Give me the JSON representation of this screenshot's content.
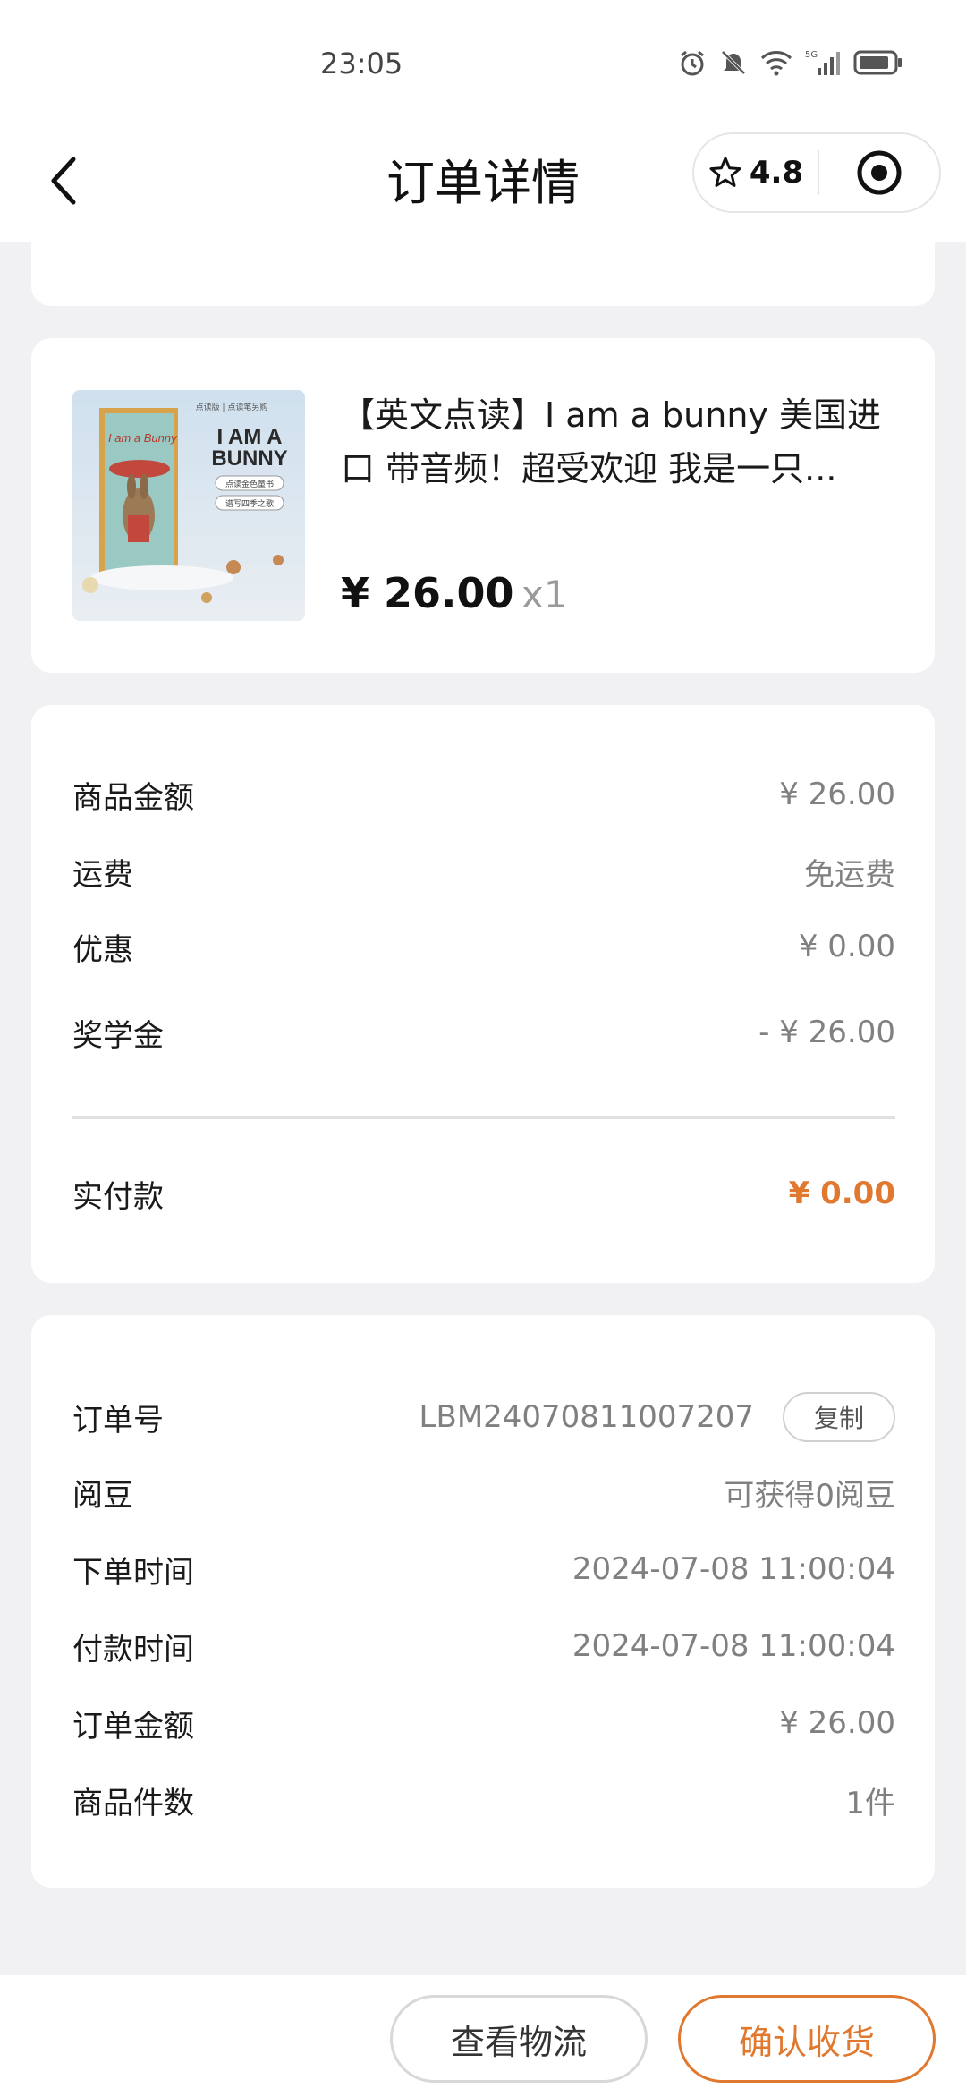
{
  "status_bar": {
    "time": "23:05",
    "icons": [
      "alarm-icon",
      "mute-icon",
      "wifi-icon",
      "signal-5g-icon",
      "battery-icon"
    ]
  },
  "nav": {
    "title": "订单详情",
    "rating": "4.8"
  },
  "product": {
    "title": "【英文点读】I am a bunny 美国进口 带音频！超受欢迎 我是一只...",
    "price": "¥ 26.00",
    "quantity": "x1",
    "image_text": {
      "header": "点读版 | 点读笔另购",
      "title_line1": "I AM A",
      "title_line2": "BUNNY",
      "cover_title": "I am a Bunny",
      "tag1": "点读金色童书",
      "tag2": "谱写四季之歌"
    }
  },
  "price_summary": {
    "rows": [
      {
        "label": "商品金额",
        "value": "¥ 26.00"
      },
      {
        "label": "运费",
        "value": "免运费"
      },
      {
        "label": "优惠",
        "value": "¥ 0.00"
      },
      {
        "label": "奖学金",
        "value": "- ¥ 26.00"
      }
    ],
    "total_label": "实付款",
    "total_value": "¥ 0.00"
  },
  "order_info": {
    "order_no_label": "订单号",
    "order_no": "LBM24070811007207",
    "copy_label": "复制",
    "rows": [
      {
        "label": "阅豆",
        "value": "可获得0阅豆"
      },
      {
        "label": "下单时间",
        "value": "2024-07-08 11:00:04"
      },
      {
        "label": "付款时间",
        "value": "2024-07-08 11:00:04"
      },
      {
        "label": "订单金额",
        "value": "¥ 26.00"
      },
      {
        "label": "商品件数",
        "value": "1件"
      }
    ]
  },
  "actions": {
    "logistics_label": "查看物流",
    "confirm_label": "确认收货"
  },
  "colors": {
    "accent": "#e0782f",
    "background": "#f1f1f3",
    "card": "#ffffff"
  }
}
